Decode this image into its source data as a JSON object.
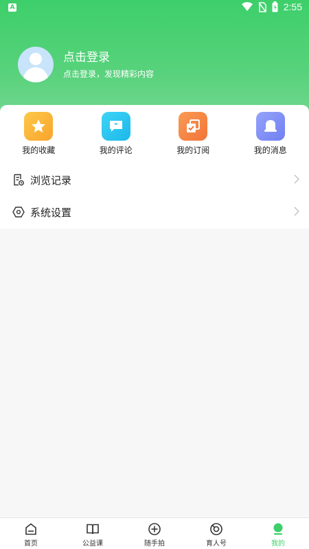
{
  "status_bar": {
    "time": "2:55",
    "notification_letter": "A"
  },
  "profile": {
    "title": "点击登录",
    "subtitle": "点击登录，发现精彩内容"
  },
  "quick_actions": [
    {
      "label": "我的收藏",
      "icon": "star-icon",
      "color": "#fbb43a"
    },
    {
      "label": "我的评论",
      "icon": "comment-icon",
      "color": "#26c4ee"
    },
    {
      "label": "我的订阅",
      "icon": "subscribe-icon",
      "color": "#f58446"
    },
    {
      "label": "我的消息",
      "icon": "bell-icon",
      "color": "#7e8ff6"
    }
  ],
  "menu": [
    {
      "label": "浏览记录",
      "icon": "history-icon"
    },
    {
      "label": "系统设置",
      "icon": "settings-icon"
    }
  ],
  "tabs": [
    {
      "label": "首页",
      "icon": "home-icon"
    },
    {
      "label": "公益课",
      "icon": "book-icon"
    },
    {
      "label": "随手拍",
      "icon": "plus-circle-icon"
    },
    {
      "label": "育人号",
      "icon": "target-icon"
    },
    {
      "label": "我的",
      "icon": "profile-icon",
      "active": true
    }
  ],
  "colors": {
    "brand": "#3dcf6a"
  }
}
